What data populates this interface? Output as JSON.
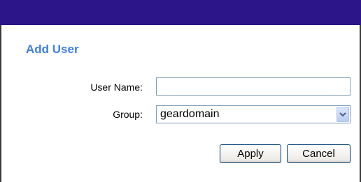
{
  "dialog": {
    "title": "Add User"
  },
  "form": {
    "username_label": "User Name:",
    "username_value": "",
    "group_label": "Group:",
    "group_selected": "geardomain"
  },
  "buttons": {
    "apply_label": "Apply",
    "cancel_label": "Cancel"
  },
  "colors": {
    "top_bar": "#2c1589",
    "title": "#3f7fe0",
    "input_border": "#7f9db9"
  },
  "icons": {
    "select_arrow": "chevron-down-icon"
  }
}
